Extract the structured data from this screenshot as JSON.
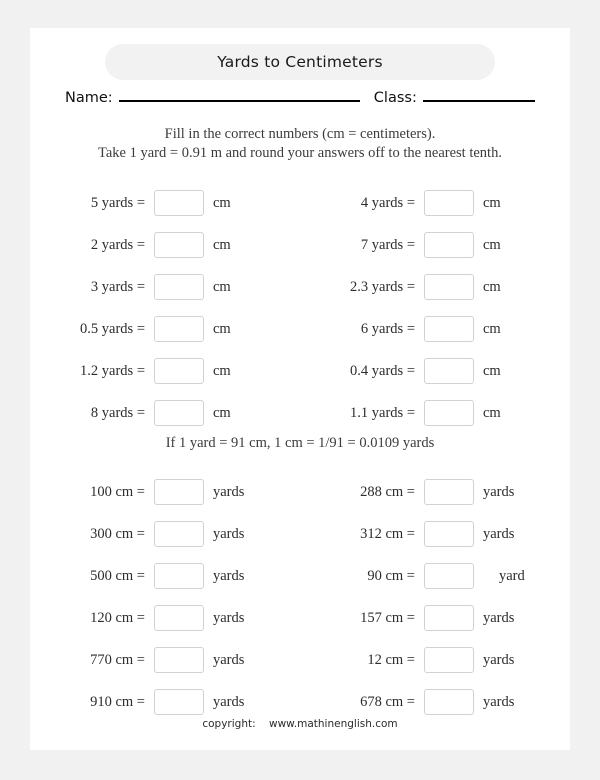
{
  "header": {
    "title": "Yards to Centimeters",
    "name_label": "Name:",
    "class_label": "Class:"
  },
  "instructions": {
    "line1": "Fill in the correct numbers (cm = centimeters).",
    "line2": "Take 1 yard = 0.91 m and round your answers off to the nearest tenth.",
    "middle": "If 1 yard = 91 cm, 1 cm = 1/91 = 0.0109 yards"
  },
  "section_yards_to_cm": {
    "rows": [
      {
        "left_label": "5 yards  =",
        "left_unit": "cm",
        "left_value": "",
        "right_label": "4 yards  =",
        "right_unit": "cm",
        "right_value": ""
      },
      {
        "left_label": "2 yards  =",
        "left_unit": "cm",
        "left_value": "",
        "right_label": "7 yards  =",
        "right_unit": "cm",
        "right_value": ""
      },
      {
        "left_label": "3 yards  =",
        "left_unit": "cm",
        "left_value": "",
        "right_label": "2.3 yards  =",
        "right_unit": "cm",
        "right_value": ""
      },
      {
        "left_label": "0.5 yards  =",
        "left_unit": "cm",
        "left_value": "",
        "right_label": "6 yards  =",
        "right_unit": "cm",
        "right_value": ""
      },
      {
        "left_label": "1.2 yards  =",
        "left_unit": "cm",
        "left_value": "",
        "right_label": "0.4 yards  =",
        "right_unit": "cm",
        "right_value": ""
      },
      {
        "left_label": "8 yards  =",
        "left_unit": "cm",
        "left_value": "",
        "right_label": "1.1 yards  =",
        "right_unit": "cm",
        "right_value": ""
      }
    ]
  },
  "section_cm_to_yards": {
    "rows": [
      {
        "left_label": "100 cm  =",
        "left_unit": "yards",
        "left_value": "",
        "right_label": "288 cm  =",
        "right_unit": "yards",
        "right_value": ""
      },
      {
        "left_label": "300 cm  =",
        "left_unit": "yards",
        "left_value": "",
        "right_label": "312 cm  =",
        "right_unit": "yards",
        "right_value": ""
      },
      {
        "left_label": "500 cm  =",
        "left_unit": "yards",
        "left_value": "",
        "right_label": "90 cm  =",
        "right_unit": "yard",
        "right_value": ""
      },
      {
        "left_label": "120 cm  =",
        "left_unit": "yards",
        "left_value": "",
        "right_label": "157 cm  =",
        "right_unit": "yards",
        "right_value": ""
      },
      {
        "left_label": "770 cm  =",
        "left_unit": "yards",
        "left_value": "",
        "right_label": "12 cm  =",
        "right_unit": "yards",
        "right_value": ""
      },
      {
        "left_label": "910 cm  =",
        "left_unit": "yards",
        "left_value": "",
        "right_label": "678 cm  =",
        "right_unit": "yards",
        "right_value": ""
      }
    ]
  },
  "footer": {
    "copyright_label": "copyright:",
    "url": "www.mathinenglish.com"
  }
}
